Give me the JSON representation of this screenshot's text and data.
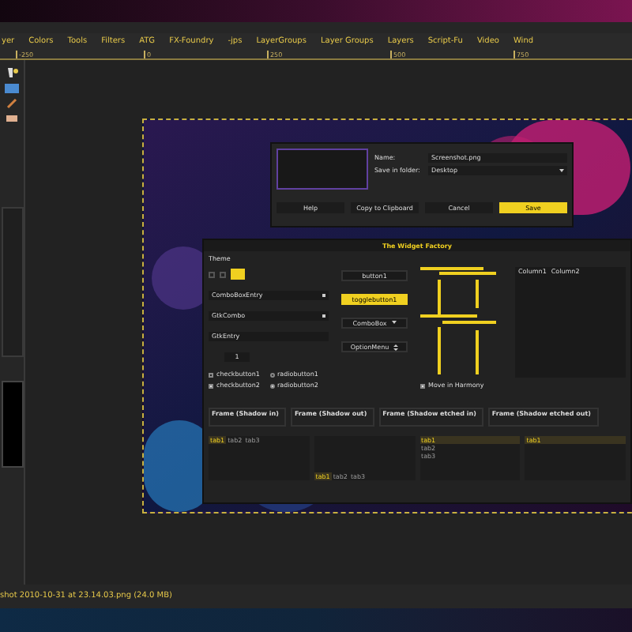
{
  "menu_bar": {
    "items": [
      "yer",
      "Colors",
      "Tools",
      "Filters",
      "ATG",
      "FX-Foundry",
      "-jps",
      "LayerGroups",
      "Layer Groups",
      "Layers",
      "Script-Fu",
      "Video",
      "Wind"
    ]
  },
  "ruler": {
    "ticks": [
      "-250",
      "0",
      "250",
      "500",
      "750"
    ]
  },
  "save_dialog": {
    "fields": [
      {
        "label": "Name:",
        "value": "Screenshot.png",
        "kind": "entry"
      },
      {
        "label": "Save in folder:",
        "value": "Desktop",
        "kind": "combo"
      }
    ],
    "buttons": [
      {
        "label": "Help",
        "primary": false
      },
      {
        "label": "Copy to Clipboard",
        "primary": false
      },
      {
        "label": "Cancel",
        "primary": false
      },
      {
        "label": "Save",
        "primary": true
      }
    ]
  },
  "widget_factory": {
    "title": "The Widget Factory",
    "theme_label": "Theme",
    "combos": [
      {
        "label": "ComboBoxEntry",
        "kind": "combo"
      },
      {
        "label": "GtkCombo",
        "kind": "combo"
      },
      {
        "label": "GtkEntry",
        "kind": "entry"
      }
    ],
    "spin": "1",
    "checks": [
      {
        "label": "checkbutton1",
        "checked": false
      },
      {
        "label": "checkbutton2",
        "checked": true
      }
    ],
    "radios": [
      {
        "label": "radiobutton1",
        "selected": false
      },
      {
        "label": "radiobutton2",
        "selected": true
      }
    ],
    "buttons": [
      {
        "label": "button1",
        "kind": "button",
        "on": false
      },
      {
        "label": "togglebutton1",
        "kind": "toggle",
        "on": true
      },
      {
        "label": "ComboBox",
        "kind": "combo",
        "on": false
      },
      {
        "label": "OptionMenu",
        "kind": "option",
        "on": false
      }
    ],
    "harmony": {
      "label": "Move in Harmony",
      "checked": true
    },
    "columns": [
      "Column1",
      "Column2"
    ],
    "frames": [
      "Frame (Shadow in)",
      "Frame (Shadow out)",
      "Frame (Shadow etched in)",
      "Frame (Shadow etched out)"
    ],
    "tab_groups": [
      {
        "tabs": [
          {
            "label": "tab1",
            "selected": true
          },
          {
            "label": "tab2",
            "selected": false
          },
          {
            "label": "tab3",
            "selected": false
          }
        ]
      },
      {
        "tabs": [
          {
            "label": "tab1",
            "selected": true
          },
          {
            "label": "tab2",
            "selected": false
          },
          {
            "label": "tab3",
            "selected": false
          }
        ]
      },
      {
        "tabs": [
          {
            "label": "tab1",
            "selected": true
          },
          {
            "label": "tab2",
            "selected": false
          },
          {
            "label": "tab3",
            "selected": false
          }
        ]
      },
      {
        "tabs": [
          {
            "label": "tab1",
            "selected": true
          }
        ]
      }
    ]
  },
  "status_bar": {
    "text": "shot 2010-10-31 at 23.14.03.png (24.0 MB)"
  }
}
